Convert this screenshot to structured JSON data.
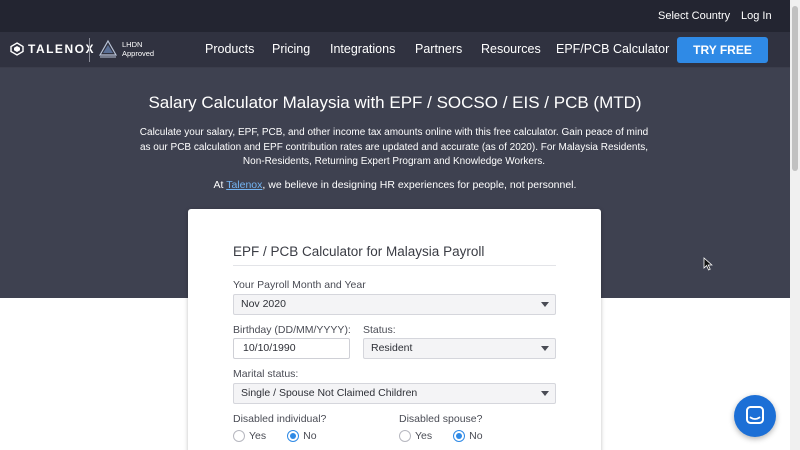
{
  "topbar": {
    "select_country": "Select Country",
    "login": "Log In"
  },
  "brand": {
    "name": "TALENOX",
    "badge_line1": "LHDN",
    "badge_line2": "Approved"
  },
  "nav": {
    "items": [
      {
        "label": "Products"
      },
      {
        "label": "Pricing"
      },
      {
        "label": "Integrations"
      },
      {
        "label": "Partners"
      },
      {
        "label": "Resources"
      },
      {
        "label": "EPF/PCB Calculator"
      }
    ],
    "cta": "TRY FREE"
  },
  "hero": {
    "title": "Salary Calculator Malaysia with EPF / SOCSO / EIS / PCB (MTD)",
    "description": "Calculate your salary, EPF, PCB, and other income tax amounts online with this free calculator. Gain peace of mind as our PCB calculation and EPF contribution rates are updated and accurate (as of 2020). For Malaysia Residents, Non-Residents, Returning Expert Program and Knowledge Workers.",
    "belief_prefix": "At ",
    "belief_link": "Talenox",
    "belief_suffix": ", we believe in designing HR experiences for people, not personnel."
  },
  "form": {
    "title": "EPF / PCB Calculator for Malaysia Payroll",
    "payroll_month_label": "Your Payroll Month and Year",
    "payroll_month_value": "Nov 2020",
    "birthday_label": "Birthday (DD/MM/YYYY):",
    "birthday_value": "10/10/1990",
    "status_label": "Status:",
    "status_value": "Resident",
    "marital_label": "Marital status:",
    "marital_value": "Single / Spouse Not Claimed Children",
    "disabled_individual_label": "Disabled individual?",
    "disabled_spouse_label": "Disabled spouse?",
    "yes": "Yes",
    "no": "No",
    "disabled_individual_selected": "No",
    "disabled_spouse_selected": "No"
  },
  "colors": {
    "accent": "#2f8ae6",
    "topbar": "#232531",
    "navbar": "#303240",
    "hero": "#3e4150"
  }
}
